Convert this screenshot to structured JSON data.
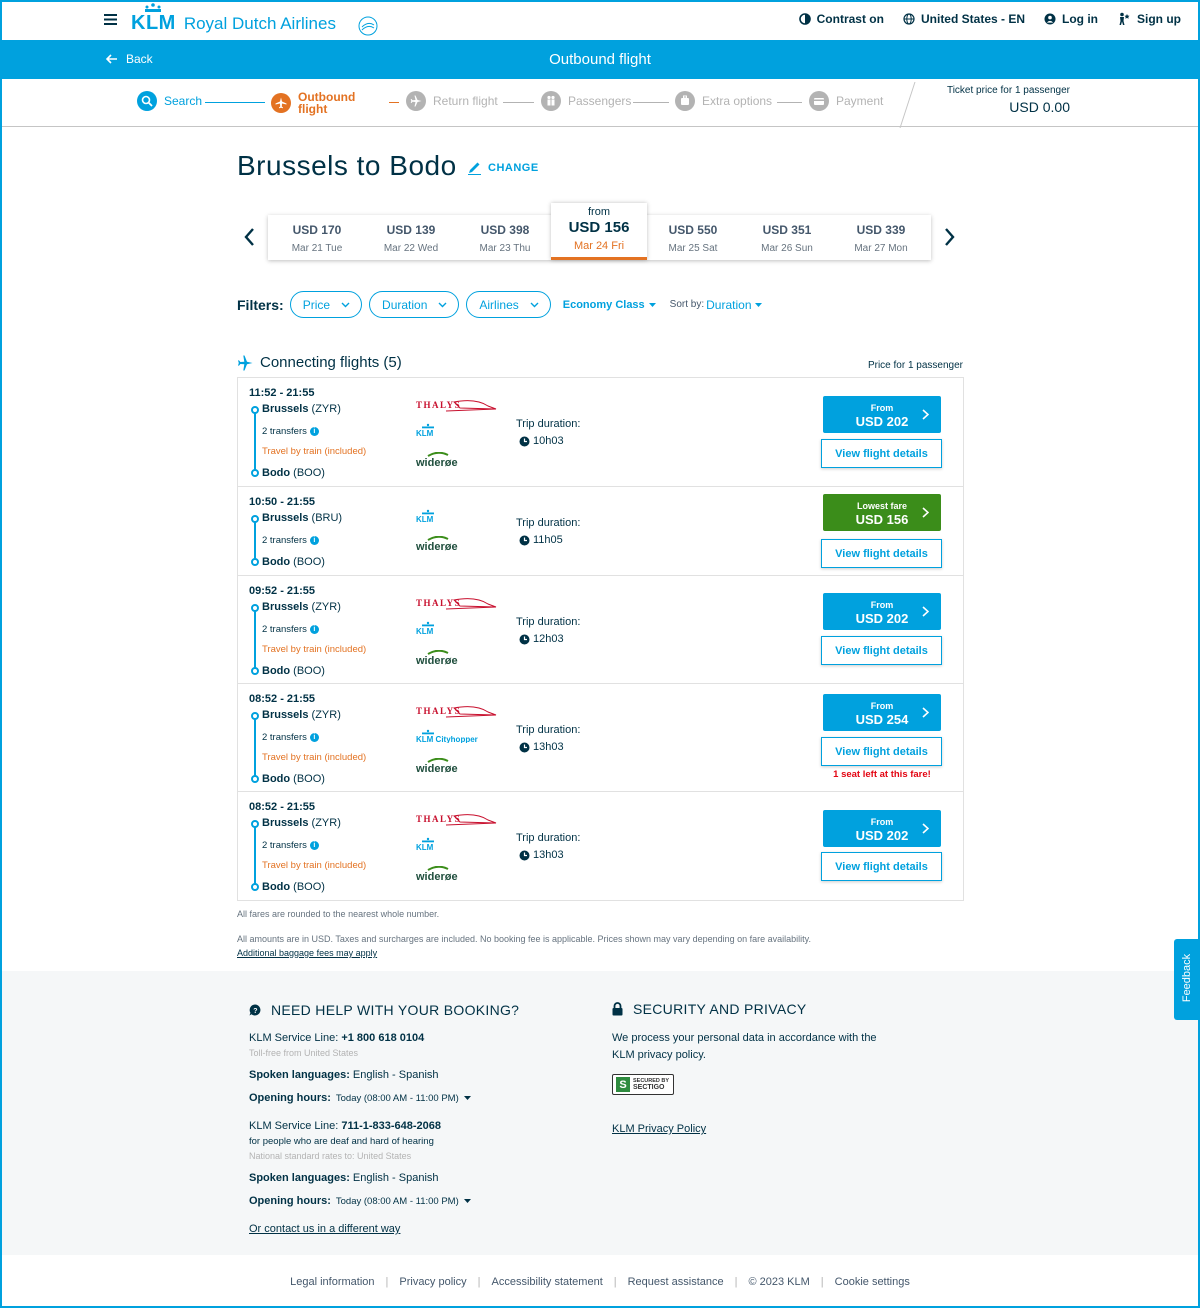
{
  "header": {
    "brand_klm": "KLM",
    "brand_name": "Royal Dutch Airlines",
    "contrast": "Contrast on",
    "locale": "United States - EN",
    "login": "Log in",
    "signup": "Sign up"
  },
  "bluebar": {
    "back": "Back",
    "title": "Outbound flight"
  },
  "stepper": {
    "steps": [
      {
        "label": "Search",
        "state": "done"
      },
      {
        "label": "Outbound\nflight",
        "state": "active"
      },
      {
        "label": "Return flight",
        "state": "todo"
      },
      {
        "label": "Passengers",
        "state": "todo"
      },
      {
        "label": "Extra options",
        "state": "todo"
      },
      {
        "label": "Payment",
        "state": "todo"
      }
    ],
    "ticket_label": "Ticket price for 1 passenger",
    "ticket_value": "USD 0.00"
  },
  "route": {
    "title": "Brussels to Bodo",
    "change": "CHANGE"
  },
  "dates": [
    {
      "price": "USD 170",
      "date": "Mar 21 Tue"
    },
    {
      "price": "USD 139",
      "date": "Mar 22 Wed"
    },
    {
      "price": "USD 398",
      "date": "Mar 23 Thu"
    },
    {
      "price": "USD 156",
      "date": "Mar 24 Fri",
      "from": "from",
      "selected": true
    },
    {
      "price": "USD 550",
      "date": "Mar 25 Sat"
    },
    {
      "price": "USD 351",
      "date": "Mar 26 Sun"
    },
    {
      "price": "USD 339",
      "date": "Mar 27 Mon"
    }
  ],
  "filters": {
    "label": "Filters:",
    "price": "Price",
    "duration": "Duration",
    "airlines": "Airlines",
    "cabin": "Economy Class",
    "sort_label": "Sort by:",
    "sort_value": "Duration"
  },
  "results": {
    "heading": "Connecting flights (5)",
    "price_for": "Price for 1 passenger",
    "trip_label": "Trip duration:",
    "view": "View flight details",
    "flights": [
      {
        "time": "11:52 - 21:55",
        "from_city": "Brussels",
        "from_code": "(ZYR)",
        "transfers": "2 transfers",
        "train": "Travel by train (included)",
        "to_city": "Bodo",
        "to_code": "(BOO)",
        "duration": "10h03",
        "fare_label": "From",
        "fare": "USD 202",
        "airlines": [
          "THALYS",
          "KLM",
          "widerøe"
        ]
      },
      {
        "time": "10:50 - 21:55",
        "from_city": "Brussels",
        "from_code": "(BRU)",
        "transfers": "2 transfers",
        "train": "",
        "to_city": "Bodo",
        "to_code": "(BOO)",
        "duration": "11h05",
        "fare_label": "Lowest fare",
        "fare": "USD 156",
        "airlines": [
          "KLM",
          "widerøe"
        ]
      },
      {
        "time": "09:52 - 21:55",
        "from_city": "Brussels",
        "from_code": "(ZYR)",
        "transfers": "2 transfers",
        "train": "Travel by train (included)",
        "to_city": "Bodo",
        "to_code": "(BOO)",
        "duration": "12h03",
        "fare_label": "From",
        "fare": "USD 202",
        "airlines": [
          "THALYS",
          "KLM",
          "widerøe"
        ]
      },
      {
        "time": "08:52 - 21:55",
        "from_city": "Brussels",
        "from_code": "(ZYR)",
        "transfers": "2 transfers",
        "train": "Travel by train (included)",
        "to_city": "Bodo",
        "to_code": "(BOO)",
        "duration": "13h03",
        "fare_label": "From",
        "fare": "USD 254",
        "airlines": [
          "THALYS",
          "KLM Cityhopper",
          "widerøe"
        ],
        "seat_note": "1 seat left at this fare!"
      },
      {
        "time": "08:52 - 21:55",
        "from_city": "Brussels",
        "from_code": "(ZYR)",
        "transfers": "2 transfers",
        "train": "Travel by train (included)",
        "to_city": "Bodo",
        "to_code": "(BOO)",
        "duration": "13h03",
        "fare_label": "From",
        "fare": "USD 202",
        "airlines": [
          "THALYS",
          "KLM",
          "widerøe"
        ]
      }
    ]
  },
  "notes": {
    "rounded": "All fares are rounded to the nearest whole number.",
    "amounts": "All amounts are in USD. Taxes and surcharges are included. No booking fee is applicable. Prices shown may vary depending on fare availability.",
    "baggage": "Additional baggage fees may apply"
  },
  "help": {
    "title": "NEED HELP WITH YOUR BOOKING?",
    "line1_label": "KLM Service Line: ",
    "line1_phone": "+1 800 618 0104",
    "line1_sub": "Toll-free from United States",
    "langs_label": "Spoken languages: ",
    "langs": "English - Spanish",
    "hours_label": "Opening hours: ",
    "hours": "Today (08:00 AM - 11:00 PM)",
    "line2_label": "KLM Service Line: ",
    "line2_phone": "711-1-833-648-2068",
    "line2_desc": "for people who are deaf and hard of hearing",
    "line2_sub": "National standard rates to: United States",
    "contact": "Or contact us in a different way"
  },
  "security": {
    "title": "SECURITY AND PRIVACY",
    "text1": "We process your personal data in accordance with the",
    "text2": "KLM privacy policy.",
    "badge1": "SECURED BY",
    "badge2": "SECTIGO",
    "policy_link": "KLM Privacy Policy"
  },
  "footer": [
    "Legal information",
    "Privacy policy",
    "Accessibility statement",
    "Request assistance",
    "© 2023 KLM",
    "Cookie settings"
  ],
  "feedback": "Feedback",
  "colors": {
    "klm_blue": "#00a1de",
    "navy": "#003145",
    "orange": "#e37222",
    "green": "#3b8d1a",
    "alert_red": "#e30613"
  }
}
